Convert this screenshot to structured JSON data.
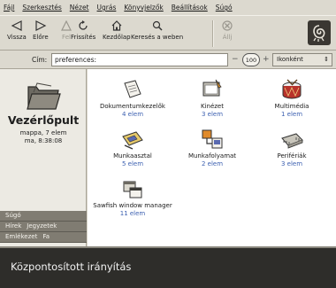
{
  "menubar": {
    "items": [
      "Fájl",
      "Szerkesztés",
      "Nézet",
      "Ugrás",
      "Könyvjelzők",
      "Beállítások",
      "Súgó"
    ]
  },
  "toolbar": {
    "back": "Vissza",
    "forward": "Előre",
    "up": "Fel",
    "refresh": "Frissítés",
    "home": "Kezdőlap",
    "search": "Keresés a weben",
    "stop": "Állj"
  },
  "location": {
    "label": "Cím:",
    "value": "preferences:",
    "zoom": "100",
    "view_mode": "Ikonként"
  },
  "sidebar": {
    "title": "Vezérlőpult",
    "info_line1": "mappa, 7 elem",
    "info_line2": "ma, 8:38:08",
    "tabs": {
      "help": "Súgó",
      "news": "Hírek",
      "notes": "Jegyzetek",
      "history": "Emlékezet",
      "tree": "Fa"
    }
  },
  "items": [
    {
      "label": "Dokumentumkezelők",
      "count": "4 elem",
      "icon": "document-handlers-icon"
    },
    {
      "label": "Kinézet",
      "count": "3 elem",
      "icon": "appearance-icon"
    },
    {
      "label": "Multimédia",
      "count": "1 elem",
      "icon": "multimedia-drum-icon"
    },
    {
      "label": "Munkaasztal",
      "count": "5 elem",
      "icon": "desktop-icon"
    },
    {
      "label": "Munkafolyamat",
      "count": "2 elem",
      "icon": "workflow-icon"
    },
    {
      "label": "Perifériák",
      "count": "3 elem",
      "icon": "peripherals-chip-icon"
    },
    {
      "label": "Sawfish window manager",
      "count": "11 elem",
      "icon": "sawfish-windows-icon"
    }
  ],
  "caption": {
    "text": "Központosított irányítás"
  }
}
